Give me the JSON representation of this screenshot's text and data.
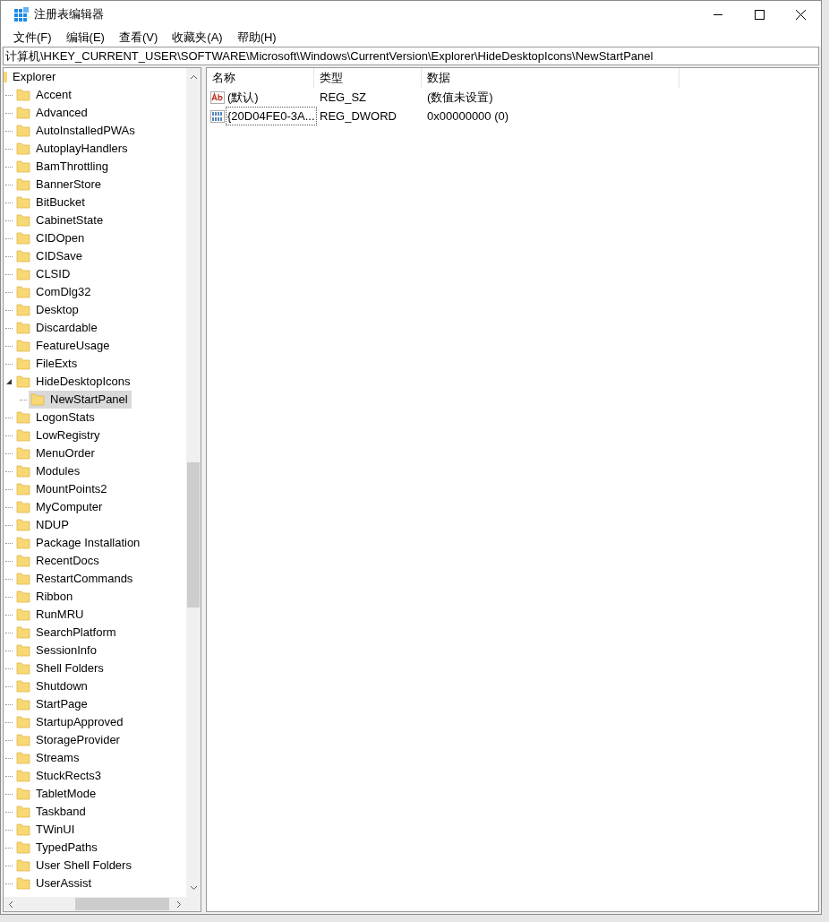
{
  "window": {
    "title": "注册表编辑器"
  },
  "menu": [
    "文件(F)",
    "编辑(E)",
    "查看(V)",
    "收藏夹(A)",
    "帮助(H)"
  ],
  "address": "计算机\\HKEY_CURRENT_USER\\SOFTWARE\\Microsoft\\Windows\\CurrentVersion\\Explorer\\HideDesktopIcons\\NewStartPanel",
  "tree": {
    "label": "Explorer",
    "selected": false,
    "children": [
      {
        "label": "Accent",
        "selected": false
      },
      {
        "label": "Advanced",
        "selected": false
      },
      {
        "label": "AutoInstalledPWAs",
        "selected": false
      },
      {
        "label": "AutoplayHandlers",
        "selected": false
      },
      {
        "label": "BamThrottling",
        "selected": false
      },
      {
        "label": "BannerStore",
        "selected": false
      },
      {
        "label": "BitBucket",
        "selected": false
      },
      {
        "label": "CabinetState",
        "selected": false
      },
      {
        "label": "CIDOpen",
        "selected": false
      },
      {
        "label": "CIDSave",
        "selected": false
      },
      {
        "label": "CLSID",
        "selected": false
      },
      {
        "label": "ComDlg32",
        "selected": false
      },
      {
        "label": "Desktop",
        "selected": false
      },
      {
        "label": "Discardable",
        "selected": false
      },
      {
        "label": "FeatureUsage",
        "selected": false
      },
      {
        "label": "FileExts",
        "selected": false
      },
      {
        "label": "HideDesktopIcons",
        "selected": false,
        "children": [
          {
            "label": "NewStartPanel",
            "selected": true
          }
        ]
      },
      {
        "label": "LogonStats",
        "selected": false
      },
      {
        "label": "LowRegistry",
        "selected": false
      },
      {
        "label": "MenuOrder",
        "selected": false
      },
      {
        "label": "Modules",
        "selected": false
      },
      {
        "label": "MountPoints2",
        "selected": false
      },
      {
        "label": "MyComputer",
        "selected": false
      },
      {
        "label": "NDUP",
        "selected": false
      },
      {
        "label": "Package Installation",
        "selected": false
      },
      {
        "label": "RecentDocs",
        "selected": false
      },
      {
        "label": "RestartCommands",
        "selected": false
      },
      {
        "label": "Ribbon",
        "selected": false
      },
      {
        "label": "RunMRU",
        "selected": false
      },
      {
        "label": "SearchPlatform",
        "selected": false
      },
      {
        "label": "SessionInfo",
        "selected": false
      },
      {
        "label": "Shell Folders",
        "selected": false
      },
      {
        "label": "Shutdown",
        "selected": false
      },
      {
        "label": "StartPage",
        "selected": false
      },
      {
        "label": "StartupApproved",
        "selected": false
      },
      {
        "label": "StorageProvider",
        "selected": false
      },
      {
        "label": "Streams",
        "selected": false
      },
      {
        "label": "StuckRects3",
        "selected": false
      },
      {
        "label": "TabletMode",
        "selected": false
      },
      {
        "label": "Taskband",
        "selected": false
      },
      {
        "label": "TWinUI",
        "selected": false
      },
      {
        "label": "TypedPaths",
        "selected": false
      },
      {
        "label": "User Shell Folders",
        "selected": false
      },
      {
        "label": "UserAssist",
        "selected": false
      }
    ]
  },
  "values": {
    "columns": [
      "名称",
      "类型",
      "数据"
    ],
    "rows": [
      {
        "kind": "string",
        "name": "(默认)",
        "type": "REG_SZ",
        "data": "(数值未设置)",
        "focused": false
      },
      {
        "kind": "dword",
        "name": "{20D04FE0-3A...",
        "type": "REG_DWORD",
        "data": "0x00000000 (0)",
        "focused": true
      }
    ]
  }
}
